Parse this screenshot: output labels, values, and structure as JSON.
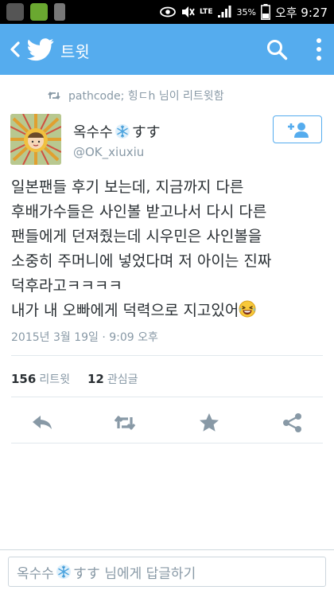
{
  "status_bar": {
    "network": "LTE",
    "battery_percent": "35%",
    "time": "오후 9:27"
  },
  "app_bar": {
    "title": "트윗",
    "icons": [
      "back-arrow-icon",
      "twitter-bird-icon",
      "search-icon",
      "more-vertical-icon"
    ]
  },
  "retweet_context": {
    "text": "pathcode; 힝ㄷh 님이 리트윗함"
  },
  "author": {
    "name_part1": "옥수수",
    "name_part2": "すす",
    "handle": "@OK_xiuxiu"
  },
  "tweet": {
    "lines": [
      "일본팬들 후기 보는데, 지금까지 다른",
      "후배가수들은 사인볼 받고나서 다시 다른",
      "팬들에게 던져줬는데 시우민은 사인볼을",
      "소중히 주머니에 넣었다며 저 아이는 진짜",
      "덕후라고ㅋㅋㅋㅋ",
      "내가 내 오빠에게 덕력으로 지고있어"
    ],
    "timestamp": "2015년 3월 19일 · 9:09 오후"
  },
  "stats": {
    "retweets_count": "156",
    "retweets_label": "리트윗",
    "favorites_count": "12",
    "favorites_label": "관심글"
  },
  "reply": {
    "placeholder_name1": "옥수수",
    "placeholder_name2": "すす",
    "placeholder_suffix": " 님에게 답글하기"
  },
  "colors": {
    "brand": "#55acee",
    "text": "#292f33",
    "muted": "#8899a6"
  }
}
